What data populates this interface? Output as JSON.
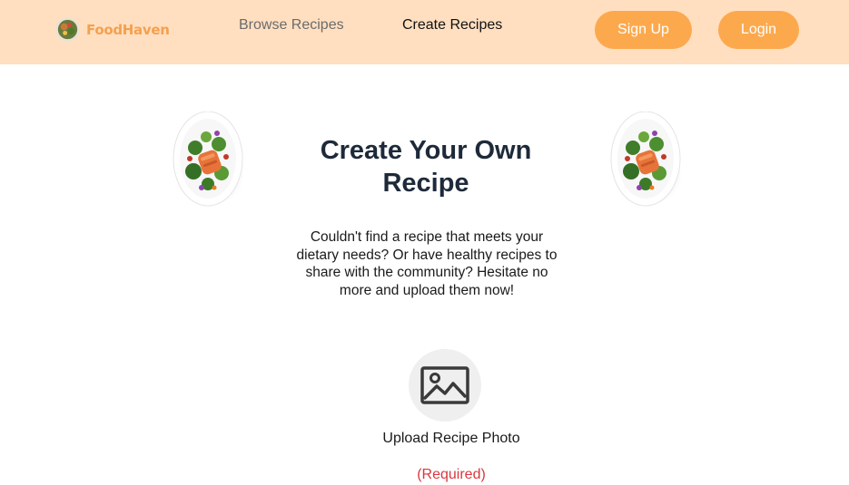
{
  "brand": {
    "name": "FoodHaven",
    "color": "#f5a04f"
  },
  "nav": {
    "links": [
      {
        "label": "Browse Recipes"
      },
      {
        "label": "Create Recipes"
      }
    ],
    "signup_label": "Sign Up",
    "login_label": "Login",
    "background": "#ffdfc0",
    "button_color": "#fca94d"
  },
  "main": {
    "title": "Create Your Own Recipe",
    "description": "Couldn't find a recipe that meets your dietary needs? Or have healthy recipes to share with the community? Hesitate no more and upload them now!",
    "upload": {
      "icon": "image-icon",
      "label": "Upload Recipe Photo",
      "required_text": "(Required)"
    }
  },
  "decorations": {
    "dish_icon": "salmon-salad-plate"
  }
}
